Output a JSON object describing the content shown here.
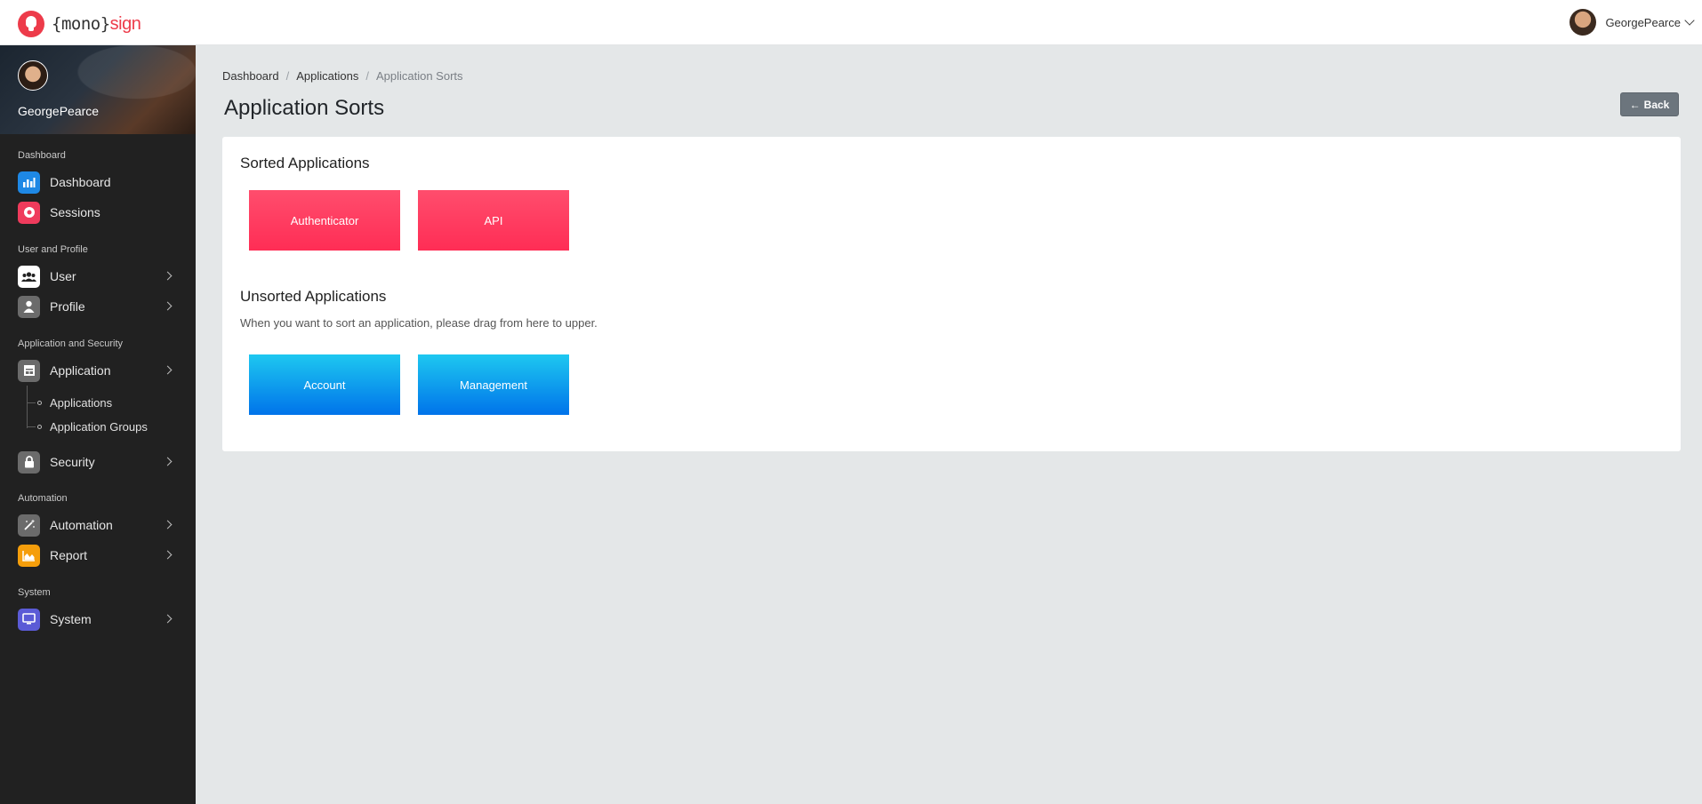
{
  "header": {
    "brand_open": "{mono}",
    "brand_accent": "sign",
    "user_name": "GeorgePearce"
  },
  "sidebar": {
    "profile_name": "GeorgePearce",
    "sections": {
      "dashboard": "Dashboard",
      "user_profile": "User and Profile",
      "app_security": "Application and Security",
      "automation": "Automation",
      "system": "System"
    },
    "items": {
      "dashboard": {
        "label": "Dashboard",
        "icon": "chart-bar-icon",
        "color": "#1e88e5"
      },
      "sessions": {
        "label": "Sessions",
        "icon": "record-icon",
        "color": "#ef3b5c"
      },
      "user": {
        "label": "User",
        "icon": "users-icon",
        "color": "#ffffff"
      },
      "profile": {
        "label": "Profile",
        "icon": "person-icon",
        "color": "#6b6b6b"
      },
      "application": {
        "label": "Application",
        "icon": "app-window-icon",
        "color": "#6b6b6b"
      },
      "security": {
        "label": "Security",
        "icon": "lock-icon",
        "color": "#6b6b6b"
      },
      "automation": {
        "label": "Automation",
        "icon": "magic-wand-icon",
        "color": "#6b6b6b"
      },
      "report": {
        "label": "Report",
        "icon": "area-chart-icon",
        "color": "#f59e0b"
      },
      "system": {
        "label": "System",
        "icon": "monitor-icon",
        "color": "#5b5bd6"
      }
    },
    "sub_items": {
      "applications": "Applications",
      "application_groups": "Application Groups"
    }
  },
  "main": {
    "breadcrumb": [
      "Dashboard",
      "Applications",
      "Application Sorts"
    ],
    "title": "Application Sorts",
    "back_label": "Back",
    "sorted_title": "Sorted Applications",
    "sorted_apps": [
      "Authenticator",
      "API"
    ],
    "unsorted_title": "Unsorted Applications",
    "unsorted_hint": "When you want to sort an application, please drag from here to upper.",
    "unsorted_apps": [
      "Account",
      "Management"
    ]
  }
}
